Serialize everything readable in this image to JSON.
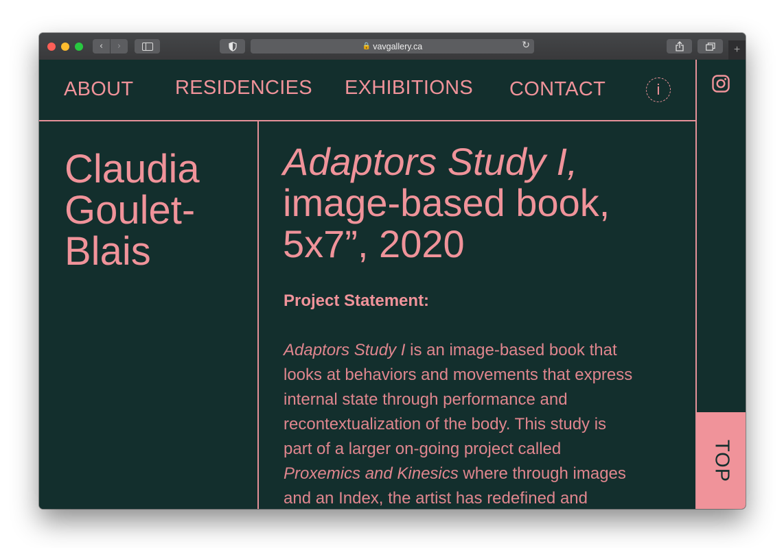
{
  "browser": {
    "url": "vavgallery.ca"
  },
  "nav": {
    "items": [
      "ABOUT",
      "RESIDENCIES",
      "EXHIBITIONS",
      "CONTACT"
    ],
    "info_label": "i"
  },
  "sidebar": {
    "top_label": "TOP"
  },
  "artist": {
    "name_lines": [
      "Claudia",
      "Goulet-",
      "Blais"
    ]
  },
  "work": {
    "title_italic": "Adaptors Study I,",
    "title_line2": "image-based book,",
    "title_line3": "5x7”, 2020"
  },
  "statement": {
    "heading": "Project Statement:",
    "line1_italic": "Adaptors Study I",
    "line1_rest": " is an image-based book that",
    "line2": "looks at behaviors and movements that express",
    "line3": "internal state through performance and",
    "line4": "recontextualization of the body. This study is",
    "line5": "part of a larger on-going project called",
    "line6_italic": "Proxemics and Kinesics",
    "line6_rest": " where through images",
    "line7": "and an Index, the artist has redefined and"
  },
  "colors": {
    "background": "#132f2d",
    "accent": "#f0939a"
  }
}
